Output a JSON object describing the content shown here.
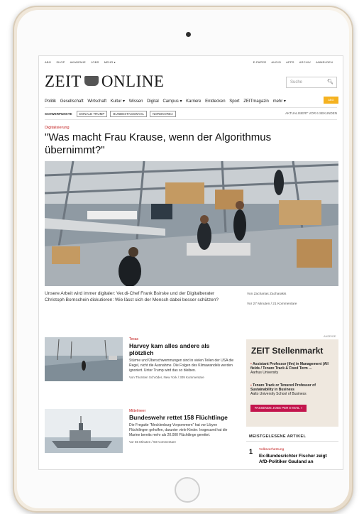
{
  "topbar": {
    "left": [
      "ABO",
      "SHOP",
      "AKADEMIE",
      "JOBS",
      "MEHR ▾"
    ],
    "right": [
      "E-PAPER",
      "AUDIO",
      "APPS",
      "ARCHIV",
      "ANMELDEN"
    ]
  },
  "logo": {
    "left": "ZEIT",
    "right": "ONLINE"
  },
  "search": {
    "placeholder": "Suche"
  },
  "nav": [
    "Politik",
    "Gesellschaft",
    "Wirtschaft",
    "Kultur ▾",
    "Wissen",
    "Digital",
    "Campus ▾",
    "Karriere",
    "Entdecken",
    "Sport",
    "ZEITmagazin",
    "mehr ▾"
  ],
  "abo_label": "ABO",
  "tags": {
    "label": "SCHWERPUNKTE",
    "items": [
      "DONALD TRUMP",
      "BUNDESTAGSWAHL",
      "NORDKOREA"
    ],
    "updated": "AKTUALISIERT VOR 6 SEKUNDEN"
  },
  "lead": {
    "kicker": "Digitalisierung",
    "headline": "\"Was macht Frau Krause, wenn der Algorithmus übernimmt?\"",
    "teaser": "Unsere Arbeit wird immer digitaler: Ver.di-Chef Frank Bsirske und der Digitalberater Christoph Bornschein diskutieren: Wie lässt sich der Mensch dabei besser schützen?",
    "byline": "Von Zacharias Zacharakis",
    "time": "Vor 27 Minuten",
    "comments": "21 Kommentare"
  },
  "articles": [
    {
      "kicker": "Texas",
      "headline": "Harvey kam alles andere als plötzlich",
      "body": "Stürme und Überschwemmungen sind in vielen Teilen der USA die Regel, nicht die Ausnahme. Die Folgen des Klimawandels werden ignoriert. Unter Trump wird das so bleiben.",
      "meta": "Von Thorsten Schröder, New York / 309 Kommentare"
    },
    {
      "kicker": "Mittelmeer",
      "headline": "Bundeswehr rettet 158 Flüchtlinge",
      "body": "Die Fregatte \"Mecklenburg-Vorpommern\" hat vor Libyen Flüchtlingen geholfen, darunter viele Kinder. Insgesamt hat die Marine bereits mehr als 20.000 Flüchtlinge gerettet.",
      "meta": "Vor 55 Minuten / 93 Kommentare"
    }
  ],
  "ad_label": "ANZEIGE",
  "stellenmarkt": {
    "title": "ZEIT Stellenmarkt",
    "jobs": [
      {
        "title": "Assistant Professor (f/m) in Management (All fields / Tenure Track & Fixed Term ...",
        "org": "Aarhus University"
      },
      {
        "title": "Tenure Track or Tenured Professor of Sustainability in Business",
        "org": "Aalto University School of Business"
      }
    ],
    "button": "PASSENDE JOBS PER E-MAIL »"
  },
  "meistgelesen": {
    "title": "MEISTGELESENE ARTIKEL",
    "items": [
      {
        "rank": "1",
        "kicker": "Volksverhetzung",
        "headline": "Ex-Bundesrichter Fischer zeigt AfD-Politiker Gauland an"
      }
    ]
  }
}
